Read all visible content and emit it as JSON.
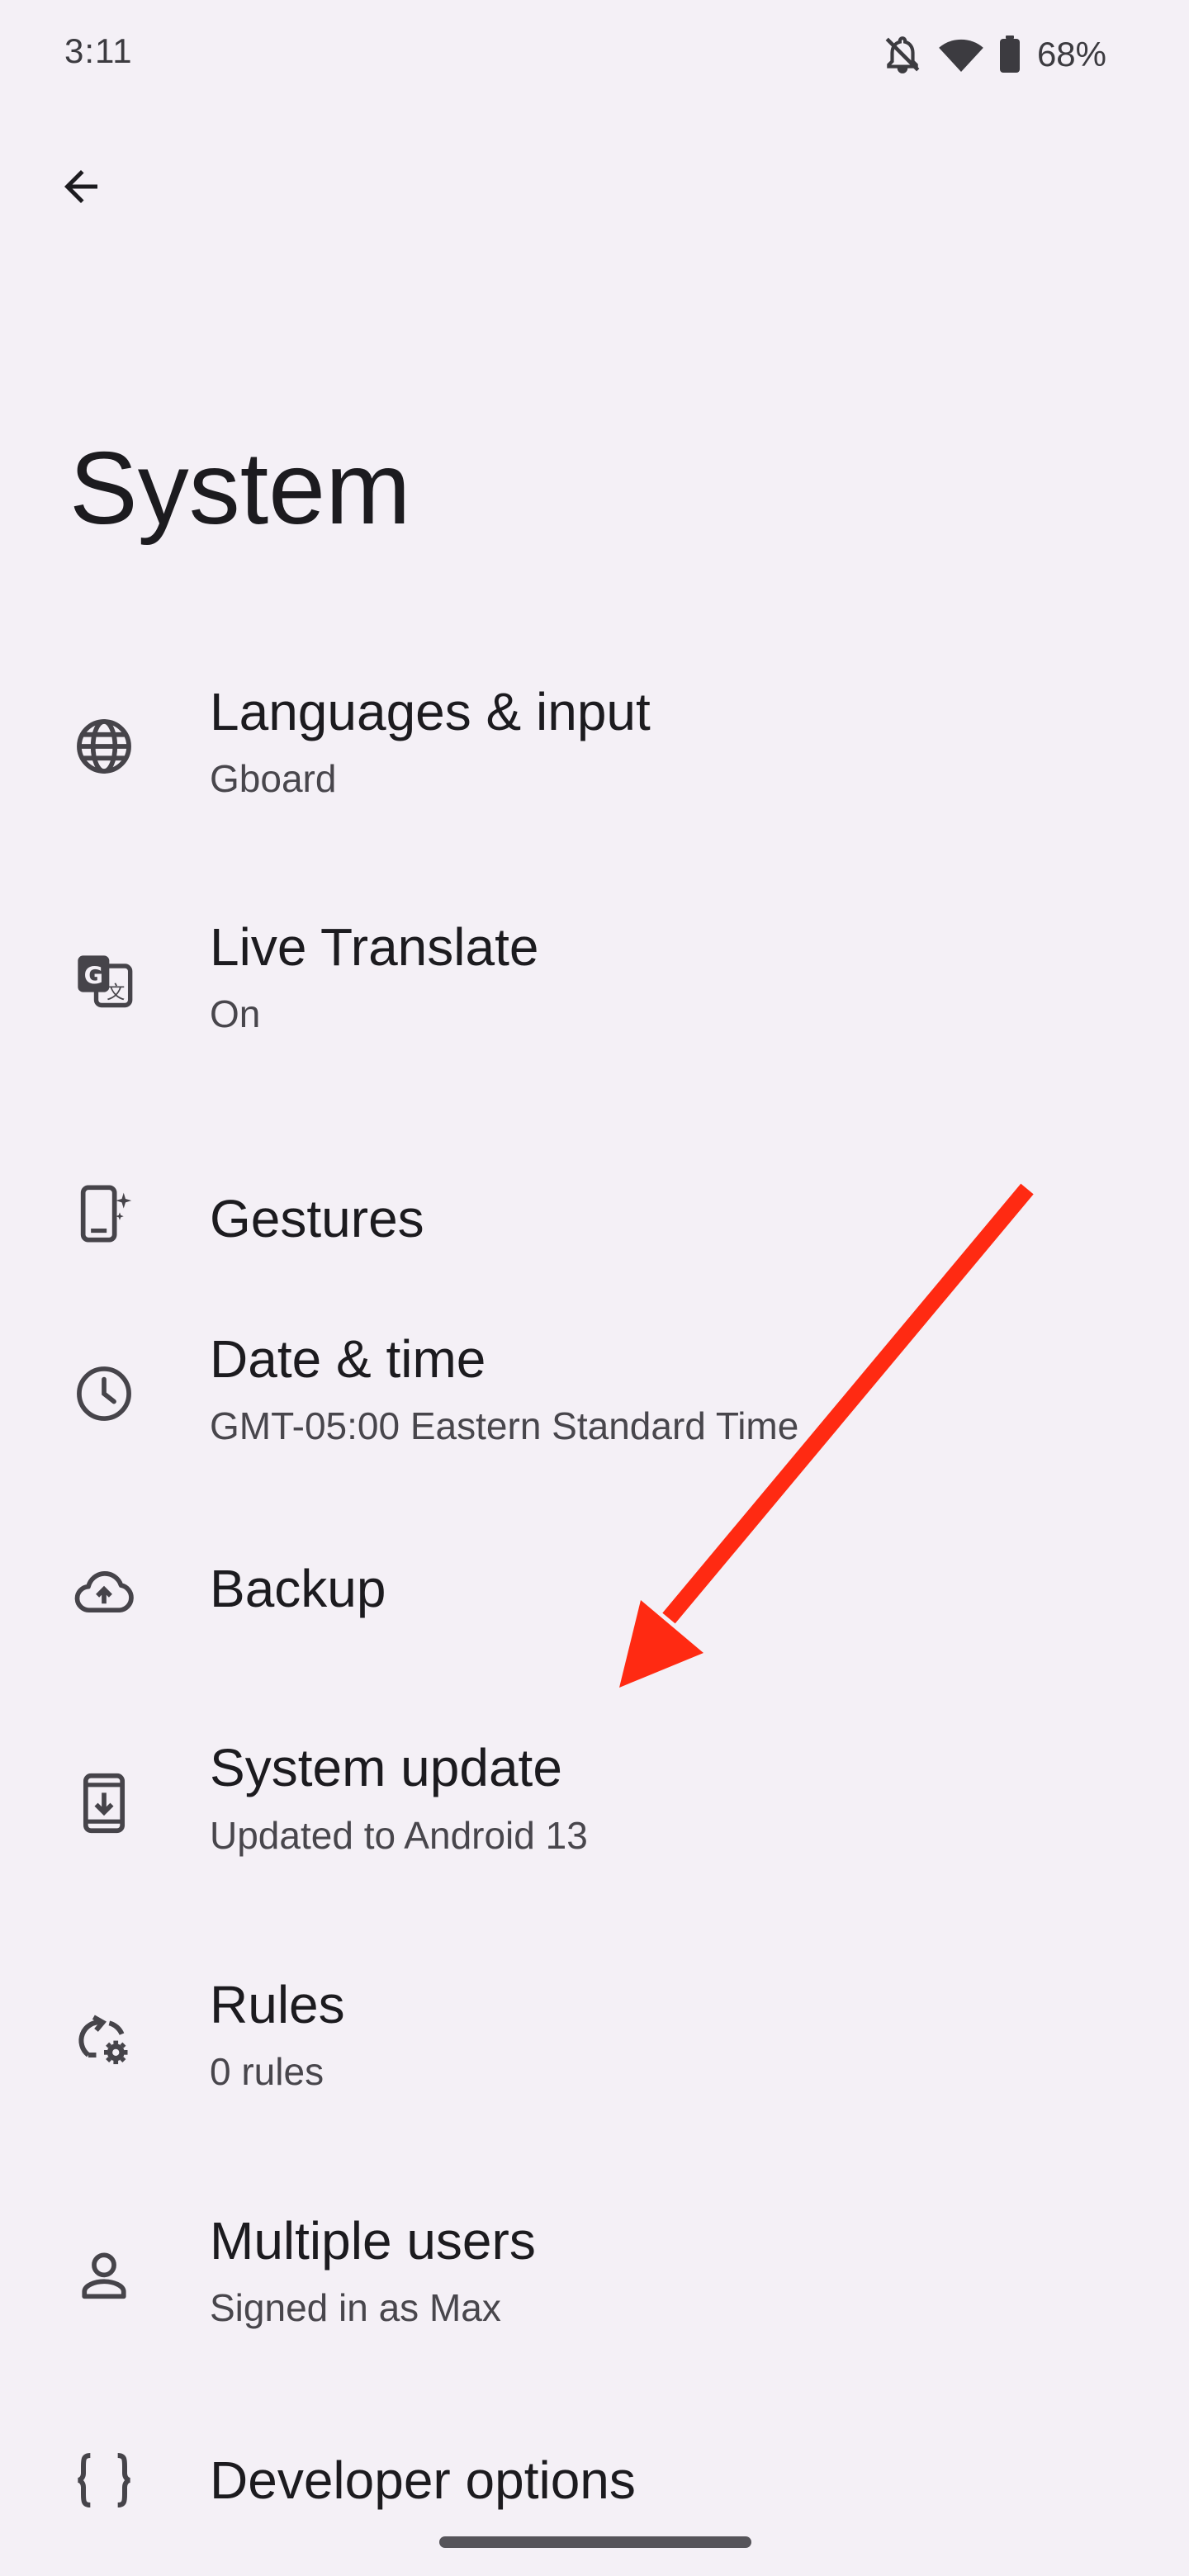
{
  "status_bar": {
    "time": "3:11",
    "battery": "68%",
    "icons": [
      "notifications-off-icon",
      "wifi-icon",
      "battery-icon"
    ]
  },
  "header": {
    "back_icon": "arrow-back-icon",
    "title": "System"
  },
  "settings": [
    {
      "icon": "globe-icon",
      "title": "Languages & input",
      "subtitle": "Gboard"
    },
    {
      "icon": "translate-icon",
      "title": "Live Translate",
      "subtitle": "On"
    },
    {
      "icon": "gestures-phone-icon",
      "title": "Gestures",
      "subtitle": ""
    },
    {
      "icon": "clock-icon",
      "title": "Date & time",
      "subtitle": "GMT-05:00 Eastern Standard Time"
    },
    {
      "icon": "cloud-upload-icon",
      "title": "Backup",
      "subtitle": ""
    },
    {
      "icon": "system-update-icon",
      "title": "System update",
      "subtitle": "Updated to Android 13"
    },
    {
      "icon": "rules-icon",
      "title": "Rules",
      "subtitle": "0 rules"
    },
    {
      "icon": "person-icon",
      "title": "Multiple users",
      "subtitle": "Signed in as Max"
    },
    {
      "icon": "braces-icon",
      "title": "Developer options",
      "subtitle": ""
    }
  ],
  "colors": {
    "background": "#f4f0f6",
    "text_primary": "#1c1b1f",
    "text_secondary": "#48464c",
    "annotation_arrow": "#ff2a12"
  }
}
